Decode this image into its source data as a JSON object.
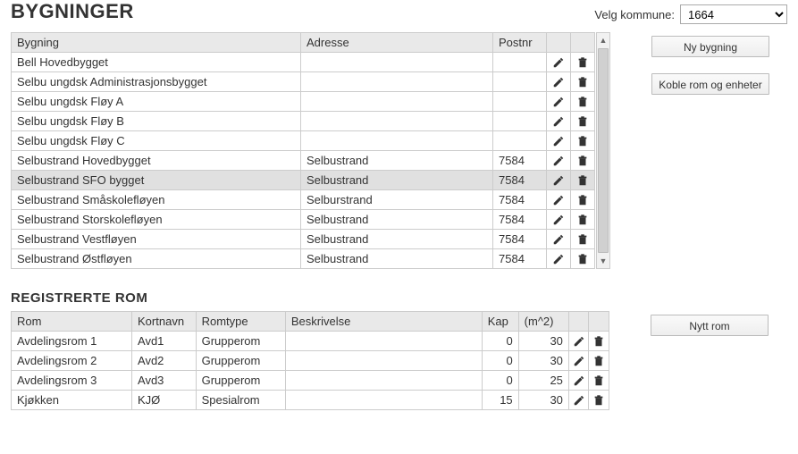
{
  "header": {
    "title": "BYGNINGER",
    "kommune_label": "Velg kommune:",
    "kommune_value": "1664"
  },
  "buildings": {
    "columns": {
      "bygning": "Bygning",
      "adresse": "Adresse",
      "postnr": "Postnr"
    },
    "rows": [
      {
        "bygning": "Bell Hovedbygget",
        "adresse": "",
        "postnr": "",
        "selected": false
      },
      {
        "bygning": "Selbu ungdsk Administrasjonsbygget",
        "adresse": "",
        "postnr": "",
        "selected": false
      },
      {
        "bygning": "Selbu ungdsk Fløy A",
        "adresse": "",
        "postnr": "",
        "selected": false
      },
      {
        "bygning": "Selbu ungdsk Fløy B",
        "adresse": "",
        "postnr": "",
        "selected": false
      },
      {
        "bygning": "Selbu ungdsk Fløy C",
        "adresse": "",
        "postnr": "",
        "selected": false
      },
      {
        "bygning": "Selbustrand Hovedbygget",
        "adresse": "Selbustrand",
        "postnr": "7584",
        "selected": false
      },
      {
        "bygning": "Selbustrand SFO bygget",
        "adresse": "Selbustrand",
        "postnr": "7584",
        "selected": true
      },
      {
        "bygning": "Selbustrand Småskolefløyen",
        "adresse": "Selburstrand",
        "postnr": "7584",
        "selected": false
      },
      {
        "bygning": "Selbustrand Storskolefløyen",
        "adresse": "Selbustrand",
        "postnr": "7584",
        "selected": false
      },
      {
        "bygning": "Selbustrand Vestfløyen",
        "adresse": "Selbustrand",
        "postnr": "7584",
        "selected": false
      },
      {
        "bygning": "Selbustrand Østfløyen",
        "adresse": "Selbustrand",
        "postnr": "7584",
        "selected": false
      }
    ]
  },
  "rooms_title": "REGISTRERTE ROM",
  "rooms": {
    "columns": {
      "rom": "Rom",
      "kort": "Kortnavn",
      "type": "Romtype",
      "beskr": "Beskrivelse",
      "kap": "Kap",
      "m2": "(m^2)"
    },
    "rows": [
      {
        "rom": "Avdelingsrom 1",
        "kort": "Avd1",
        "type": "Grupperom",
        "beskr": "",
        "kap": "0",
        "m2": "30"
      },
      {
        "rom": "Avdelingsrom 2",
        "kort": "Avd2",
        "type": "Grupperom",
        "beskr": "",
        "kap": "0",
        "m2": "30"
      },
      {
        "rom": "Avdelingsrom 3",
        "kort": "Avd3",
        "type": "Grupperom",
        "beskr": "",
        "kap": "0",
        "m2": "25"
      },
      {
        "rom": "Kjøkken",
        "kort": "KJØ",
        "type": "Spesialrom",
        "beskr": "",
        "kap": "15",
        "m2": "30"
      }
    ]
  },
  "buttons": {
    "ny_bygning": "Ny bygning",
    "koble_rom": "Koble rom og enheter",
    "nytt_rom": "Nytt rom"
  }
}
